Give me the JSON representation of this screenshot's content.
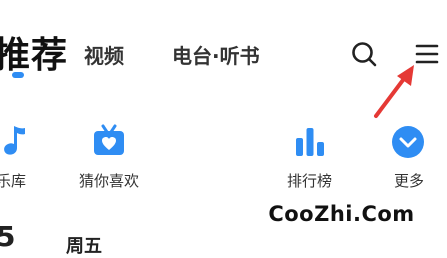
{
  "top_tabs": {
    "active": "推荐",
    "video": "视频",
    "radio_books": "电台·听书"
  },
  "quick_access": {
    "music_library": "乐库",
    "guess_you_like": "猜你喜欢",
    "charts": "排行榜",
    "more": "更多"
  },
  "watermark": "CooZhi.Com",
  "bottom_partial": {
    "number": "5",
    "text": "周五"
  },
  "colors": {
    "accent": "#2f8df3",
    "arrow": "#e53935"
  },
  "icons": {
    "search": "search-icon",
    "menu": "menu-icon",
    "music_library": "music-note-icon",
    "guess_you_like": "radio-heart-icon",
    "charts": "bar-chart-icon",
    "more": "chevron-down-circle-icon"
  }
}
